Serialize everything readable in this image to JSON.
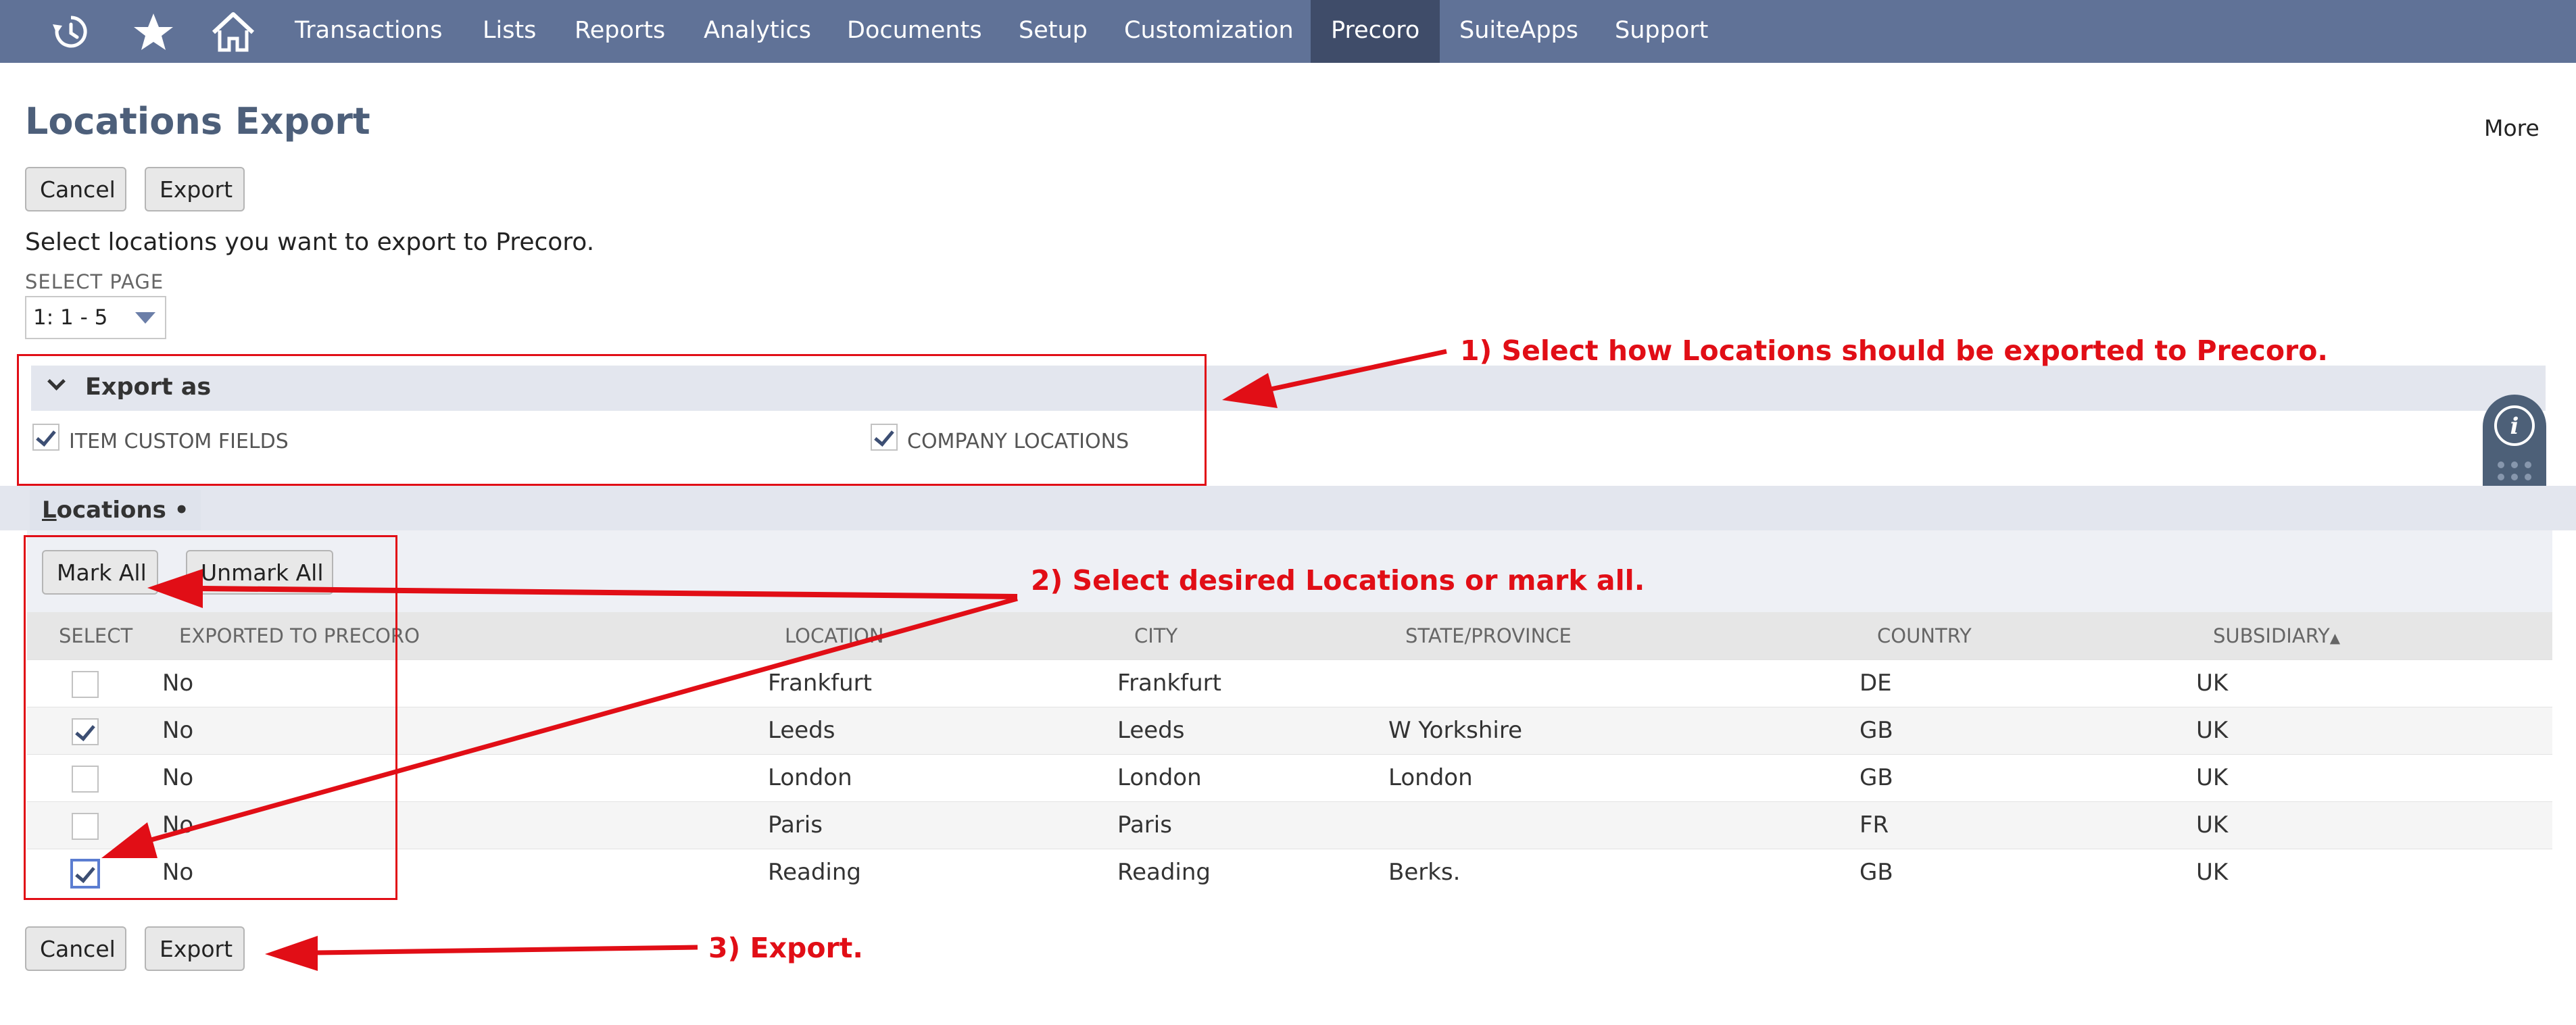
{
  "nav": {
    "icons": [
      "recent-records-icon",
      "favorites-star-icon",
      "home-icon"
    ],
    "items": [
      {
        "label": "Transactions",
        "active": false
      },
      {
        "label": "Lists",
        "active": false
      },
      {
        "label": "Reports",
        "active": false
      },
      {
        "label": "Analytics",
        "active": false
      },
      {
        "label": "Documents",
        "active": false
      },
      {
        "label": "Setup",
        "active": false
      },
      {
        "label": "Customization",
        "active": false
      },
      {
        "label": "Precoro",
        "active": true
      },
      {
        "label": "SuiteApps",
        "active": false
      },
      {
        "label": "Support",
        "active": false
      }
    ]
  },
  "page": {
    "title": "Locations Export",
    "more_label": "More",
    "instructions": "Select locations you want to export to Precoro.",
    "cancel_label": "Cancel",
    "export_label": "Export"
  },
  "select_page": {
    "label": "SELECT PAGE",
    "value": "1: 1 - 5"
  },
  "export_as": {
    "title": "Export as",
    "options": [
      {
        "label": "ITEM CUSTOM FIELDS",
        "checked": true
      },
      {
        "label": "COMPANY LOCATIONS",
        "checked": true
      }
    ]
  },
  "locations": {
    "tab_underline": "L",
    "tab_rest": "ocations",
    "tab_dot": "•",
    "mark_all_label": "Mark All",
    "unmark_all_label": "Unmark All",
    "columns": [
      "SELECT",
      "EXPORTED TO PRECORO",
      "LOCATION",
      "CITY",
      "STATE/PROVINCE",
      "COUNTRY",
      "SUBSIDIARY"
    ],
    "sorted_column_indicator": "▲",
    "rows": [
      {
        "selected": false,
        "exported": "No",
        "location": "Frankfurt",
        "city": "Frankfurt",
        "state": "",
        "country": "DE",
        "subsidiary": "UK"
      },
      {
        "selected": true,
        "exported": "No",
        "location": "Leeds",
        "city": "Leeds",
        "state": "W Yorkshire",
        "country": "GB",
        "subsidiary": "UK"
      },
      {
        "selected": false,
        "exported": "No",
        "location": "London",
        "city": "London",
        "state": "London",
        "country": "GB",
        "subsidiary": "UK"
      },
      {
        "selected": false,
        "exported": "No",
        "location": "Paris",
        "city": "Paris",
        "state": "",
        "country": "FR",
        "subsidiary": "UK"
      },
      {
        "selected": true,
        "exported": "No",
        "location": "Reading",
        "city": "Reading",
        "state": "Berks.",
        "country": "GB",
        "subsidiary": "UK"
      }
    ]
  },
  "annotations": {
    "step1": "1) Select how Locations should be exported to Precoro.",
    "step2": "2) Select desired Locations or mark all.",
    "step3": "3) Export.",
    "color": "#e10e16"
  },
  "colors": {
    "nav_bg": "#607297",
    "nav_active_bg": "#3f4c69",
    "title": "#4d5f7a",
    "checkmark": "#3c4e73"
  }
}
